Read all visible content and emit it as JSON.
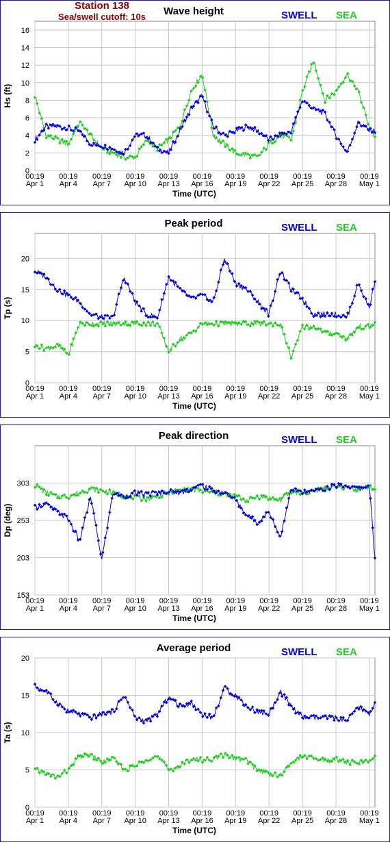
{
  "header": {
    "station": "Station 138",
    "cutoff": "Sea/swell cutoff: 10s"
  },
  "legend": {
    "swell": "SWELL",
    "sea": "SEA"
  },
  "colors": {
    "swell": "#0000e0",
    "sea": "#22cc22",
    "frame": "#1a1a9a",
    "grid": "#c8c8c8",
    "header": "#8b0000"
  },
  "x_axis": {
    "label": "Time (UTC)",
    "ticks": [
      {
        "top": "00:19",
        "bottom": "Apr 1"
      },
      {
        "top": "00:19",
        "bottom": "Apr 4"
      },
      {
        "top": "00:19",
        "bottom": "Apr 7"
      },
      {
        "top": "00:19",
        "bottom": "Apr 10"
      },
      {
        "top": "00:19",
        "bottom": "Apr 13"
      },
      {
        "top": "00:19",
        "bottom": "Apr 16"
      },
      {
        "top": "00:19",
        "bottom": "Apr 19"
      },
      {
        "top": "00:19",
        "bottom": "Apr 22"
      },
      {
        "top": "00:19",
        "bottom": "Apr 25"
      },
      {
        "top": "00:19",
        "bottom": "Apr 28"
      },
      {
        "top": "00:19",
        "bottom": "May 1"
      }
    ]
  },
  "chart_data": [
    {
      "type": "line",
      "title": "Wave height",
      "ylabel": "Hs (ft)",
      "xlabel": "Time (UTC)",
      "ylim": [
        0,
        17
      ],
      "yticks": [
        0,
        2,
        4,
        6,
        8,
        10,
        12,
        14,
        16
      ],
      "grid": true,
      "legend": "top-right",
      "x_days": [
        0,
        1,
        2,
        3,
        4,
        5,
        6,
        7,
        8,
        9,
        10,
        11,
        12,
        13,
        14,
        15,
        16,
        17,
        18,
        19,
        20,
        21,
        22,
        23,
        24,
        25,
        26,
        27,
        28,
        29,
        30,
        30.5
      ],
      "series": [
        {
          "name": "SWELL",
          "values": [
            3.5,
            5,
            5,
            4.8,
            4.5,
            3,
            2.8,
            2.5,
            2,
            4,
            4,
            2.5,
            2,
            4.5,
            7,
            8.5,
            5,
            4,
            4.5,
            5,
            4.5,
            3.5,
            4,
            4.5,
            8,
            7,
            6.5,
            4,
            2,
            5.5,
            4.5,
            4.5
          ]
        },
        {
          "name": "SEA",
          "values": [
            8.5,
            4,
            3.5,
            3,
            5.5,
            4,
            2.5,
            2,
            1.5,
            1.5,
            3.5,
            2.5,
            3.5,
            5,
            9,
            11,
            4,
            3,
            2,
            1.8,
            1.5,
            3,
            4,
            3.5,
            9,
            12.5,
            8,
            9,
            11,
            9,
            5,
            3.8
          ]
        }
      ]
    },
    {
      "type": "line",
      "title": "Peak period",
      "ylabel": "Tp (s)",
      "xlabel": "Time (UTC)",
      "ylim": [
        0,
        24
      ],
      "yticks": [
        0,
        5,
        10,
        15,
        20
      ],
      "grid": true,
      "legend": "top-right",
      "x_days": [
        0,
        1,
        2,
        3,
        4,
        5,
        6,
        7,
        8,
        9,
        10,
        11,
        12,
        13,
        14,
        15,
        16,
        17,
        18,
        19,
        20,
        21,
        22,
        23,
        24,
        25,
        26,
        27,
        28,
        29,
        30,
        30.5
      ],
      "series": [
        {
          "name": "SWELL",
          "values": [
            18,
            17,
            15,
            14,
            13,
            11,
            10.5,
            10.5,
            17,
            13,
            11,
            10.5,
            17,
            15,
            13.5,
            14,
            13,
            20,
            16,
            15,
            13,
            11,
            18,
            15,
            13.5,
            11,
            11,
            11,
            10.5,
            16,
            12,
            16.5
          ]
        },
        {
          "name": "SEA",
          "values": [
            6,
            5.5,
            6,
            4.5,
            9.5,
            9.5,
            9.5,
            9.5,
            9.5,
            9.5,
            9.5,
            9.5,
            5,
            7,
            8,
            9.5,
            9.5,
            9.5,
            9.5,
            9.5,
            9.5,
            9.5,
            9.5,
            4,
            9,
            9,
            8,
            8,
            7,
            9,
            9,
            9.5
          ]
        }
      ]
    },
    {
      "type": "line",
      "title": "Peak direction",
      "ylabel": "Dp (deg)",
      "xlabel": "Time (UTC)",
      "ylim": [
        153,
        353
      ],
      "yticks": [
        153,
        203,
        253,
        303
      ],
      "grid": true,
      "legend": "top-right",
      "x_days": [
        0,
        1,
        2,
        3,
        4,
        5,
        6,
        7,
        8,
        9,
        10,
        11,
        12,
        13,
        14,
        15,
        16,
        17,
        18,
        19,
        20,
        21,
        22,
        23,
        24,
        25,
        26,
        27,
        28,
        29,
        30,
        30.5
      ],
      "series": [
        {
          "name": "SWELL",
          "values": [
            270,
            275,
            265,
            255,
            225,
            285,
            200,
            290,
            285,
            290,
            288,
            290,
            292,
            290,
            295,
            300,
            292,
            290,
            280,
            260,
            250,
            265,
            230,
            295,
            290,
            292,
            295,
            300,
            300,
            295,
            300,
            200
          ]
        },
        {
          "name": "SEA",
          "values": [
            300,
            290,
            285,
            285,
            290,
            295,
            293,
            290,
            285,
            283,
            282,
            285,
            290,
            293,
            295,
            292,
            290,
            288,
            285,
            280,
            285,
            283,
            280,
            292,
            290,
            292,
            295,
            297,
            297,
            295,
            297,
            295
          ]
        }
      ]
    },
    {
      "type": "line",
      "title": "Average period",
      "ylabel": "Ta (s)",
      "xlabel": "Time (UTC)",
      "ylim": [
        0,
        20
      ],
      "yticks": [
        0,
        5,
        10,
        15,
        20
      ],
      "grid": true,
      "legend": "top-right",
      "x_days": [
        0,
        1,
        2,
        3,
        4,
        5,
        6,
        7,
        8,
        9,
        10,
        11,
        12,
        13,
        14,
        15,
        16,
        17,
        18,
        19,
        20,
        21,
        22,
        23,
        24,
        25,
        26,
        27,
        28,
        29,
        30,
        30.5
      ],
      "series": [
        {
          "name": "SWELL",
          "values": [
            16.2,
            15.5,
            14,
            12.8,
            12.5,
            12,
            12.5,
            12.8,
            15,
            12,
            11.5,
            12.5,
            14.8,
            13.5,
            14,
            12.5,
            12,
            16,
            15,
            13.5,
            12.8,
            12.5,
            15.5,
            13.5,
            12,
            12,
            12,
            12,
            11.5,
            13.5,
            12.5,
            14
          ]
        },
        {
          "name": "SEA",
          "values": [
            5,
            4.5,
            4,
            5,
            6.8,
            7,
            6,
            6.5,
            5,
            5.5,
            6.5,
            6.8,
            5,
            5.5,
            6.5,
            6.3,
            6.5,
            7,
            6.5,
            6.3,
            5,
            4.5,
            4.2,
            6,
            6.8,
            6.5,
            6.3,
            6.5,
            6,
            6,
            6.2,
            6.8
          ]
        }
      ]
    }
  ]
}
